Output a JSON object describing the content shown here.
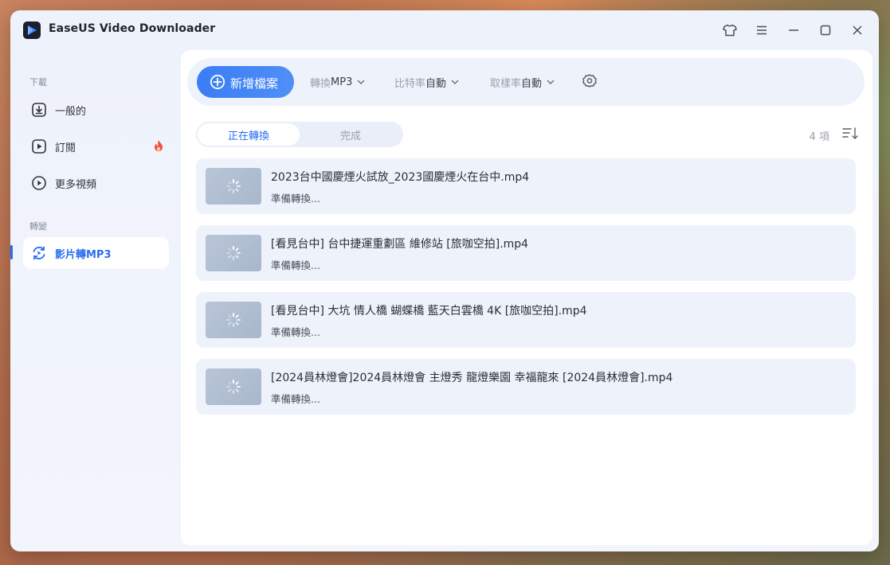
{
  "window": {
    "title": "EaseUS Video Downloader"
  },
  "sidebar": {
    "download_section": "下載",
    "items": [
      {
        "label": "一般的"
      },
      {
        "label": "訂閱"
      },
      {
        "label": "更多視頻"
      }
    ],
    "convert_section": "轉變",
    "convert_items": [
      {
        "label": "影片轉MP3"
      }
    ]
  },
  "toolbar": {
    "add_label": "新增檔案",
    "convert_key": "轉換",
    "convert_value": "MP3",
    "bitrate_key": "比特率",
    "bitrate_value": "自動",
    "samplerate_key": "取樣率",
    "samplerate_value": "自動"
  },
  "tabs": {
    "converting": "正在轉換",
    "done": "完成"
  },
  "list": {
    "count": "4 項",
    "items": [
      {
        "name": "2023台中國慶煙火試放_2023國慶煙火在台中.mp4",
        "status": "準備轉換..."
      },
      {
        "name": "[看見台中] 台中捷運重劃區 維修站 [旅咖空拍].mp4",
        "status": "準備轉換..."
      },
      {
        "name": "[看見台中]  大坑 情人橋 蝴蝶橋 藍天白雲橋 4K [旅咖空拍].mp4",
        "status": "準備轉換..."
      },
      {
        "name": "[2024員林燈會]2024員林燈會 主燈秀 龍燈樂園 幸福龍來 [2024員林燈會].mp4",
        "status": "準備轉換..."
      }
    ]
  },
  "colors": {
    "accent": "#2a6df0",
    "button_gradient_start": "#3a7df5",
    "fire": "#f0523a"
  },
  "icons": {
    "logo": "play-logo-icon",
    "skin": "tshirt-icon",
    "menu": "hamburger-icon",
    "minimize": "minimize-icon",
    "maximize": "maximize-icon",
    "close": "close-icon",
    "general": "download-box-icon",
    "subscribe": "play-box-icon",
    "more": "play-circle-icon",
    "video_to_mp3": "convert-cycle-icon",
    "hot": "fire-icon",
    "add": "plus-circle-icon",
    "settings": "gear-icon",
    "sort": "sort-icon",
    "loading": "spinner-icon"
  }
}
